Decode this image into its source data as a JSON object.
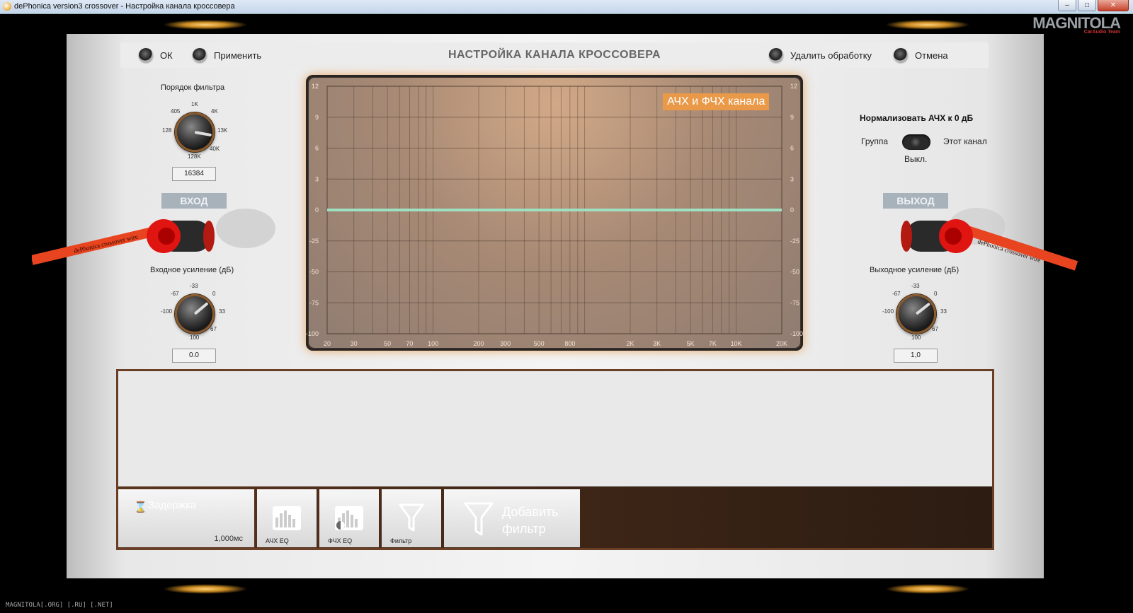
{
  "window": {
    "title": "dePhonica version3 crossover - Настройка канала кроссовера"
  },
  "logo": {
    "text": "MAGNITOLA",
    "sub": "CarAudio Team"
  },
  "footer": "MAGNITOLA[.ORG] [.RU] [.NET]",
  "toolbar": {
    "ok": "ОК",
    "apply": "Применить",
    "title": "НАСТРОЙКА КАНАЛА КРОССОВЕРА",
    "remove": "Удалить обработку",
    "cancel": "Отмена"
  },
  "filter_order": {
    "label": "Порядок фильтра",
    "ticks": [
      "1K",
      "4K",
      "13K",
      "40K",
      "128K",
      "128",
      "405"
    ],
    "value": "16384"
  },
  "input": {
    "header": "ВХОД",
    "gain_label": "Входное усиление (дБ)",
    "ticks": [
      "-33",
      "0",
      "33",
      "67",
      "100",
      "-100",
      "-67"
    ],
    "value": "0.0"
  },
  "output": {
    "header": "ВЫХОД",
    "gain_label": "Выходное усиление (дБ)",
    "ticks": [
      "-33",
      "0",
      "33",
      "67",
      "100",
      "-100",
      "-67"
    ],
    "value": "1,0"
  },
  "cables": {
    "left_text": "dePhonica crossover wire",
    "right_text": "dePhonica crossover wire"
  },
  "normalize": {
    "title": "Нормализовать АЧХ к 0 дБ",
    "left": "Группа",
    "right": "Этот канал",
    "state": "Выкл."
  },
  "graph": {
    "badge": "АЧХ и ФЧХ канала"
  },
  "chart_data": {
    "type": "line",
    "title": "АЧХ и ФЧХ канала",
    "x_scale": "log",
    "xlim": [
      20,
      20000
    ],
    "ylim": [
      -100,
      12
    ],
    "x_ticks": [
      {
        "v": 20,
        "label": "20"
      },
      {
        "v": 30,
        "label": "30"
      },
      {
        "v": 50,
        "label": "50"
      },
      {
        "v": 70,
        "label": "70"
      },
      {
        "v": 100,
        "label": "100"
      },
      {
        "v": 200,
        "label": "200"
      },
      {
        "v": 300,
        "label": "300"
      },
      {
        "v": 500,
        "label": "500"
      },
      {
        "v": 800,
        "label": "800"
      },
      {
        "v": 2000,
        "label": "2K"
      },
      {
        "v": 3000,
        "label": "3K"
      },
      {
        "v": 5000,
        "label": "5K"
      },
      {
        "v": 7000,
        "label": "7K"
      },
      {
        "v": 10000,
        "label": "10K"
      },
      {
        "v": 20000,
        "label": "20K"
      }
    ],
    "y_ticks": [
      "12",
      "9",
      "6",
      "3",
      "0",
      "-25",
      "-50",
      "-75",
      "-100"
    ],
    "grid": true,
    "series": [
      {
        "x": [
          20,
          20000
        ],
        "y": [
          0,
          0
        ],
        "color": "#9ee0c2"
      }
    ]
  },
  "chain": {
    "delay_label": "Задержка",
    "delay_value": "1,000мс",
    "slots": [
      "АЧХ EQ",
      "ФЧХ EQ",
      "Фильтр"
    ],
    "add_filter": [
      "Добавить",
      "фильтр"
    ]
  },
  "colors": {
    "accent": "#e99948",
    "frame": "#6a3f25",
    "curve": "#9ee0c2"
  }
}
